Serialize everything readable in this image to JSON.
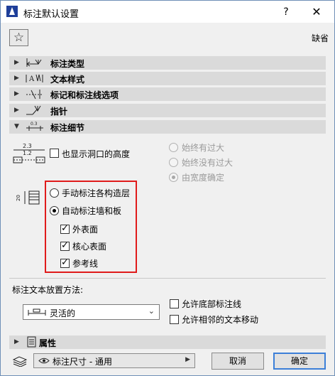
{
  "window": {
    "title": "标注默认设置",
    "help_label": "?",
    "close_label": "✕"
  },
  "toolbar": {
    "favorites_icon": "star-icon",
    "default_label": "缺省"
  },
  "sections": [
    {
      "label": "标注类型",
      "icon": "dimension-type-icon",
      "expanded": false
    },
    {
      "label": "文本样式",
      "icon": "text-style-icon",
      "expanded": false
    },
    {
      "label": "标记和标注线选项",
      "icon": "marker-options-icon",
      "expanded": false
    },
    {
      "label": "指针",
      "icon": "pointer-icon",
      "expanded": false
    },
    {
      "label": "标注细节",
      "icon": "dimension-detail-icon",
      "expanded": true
    }
  ],
  "details": {
    "icon_numbers": {
      "top": "2.3",
      "bottom": "1.2"
    },
    "show_opening_height": {
      "label": "也显示洞口的高度",
      "checked": false
    },
    "opening_options": [
      {
        "label": "始终有过大",
        "selected": false,
        "disabled": true
      },
      {
        "label": "始终没有过大",
        "selected": false,
        "disabled": true
      },
      {
        "label": "由宽度确定",
        "selected": true,
        "disabled": true
      }
    ],
    "wall_icon_number": "20",
    "wall_mode_options": [
      {
        "label": "手动标注各构造层",
        "selected": false
      },
      {
        "label": "自动标注墙和板",
        "selected": true
      }
    ],
    "auto_checks": [
      {
        "label": "外表面",
        "checked": true
      },
      {
        "label": "核心表面",
        "checked": true
      },
      {
        "label": "参考线",
        "checked": true
      }
    ]
  },
  "placement": {
    "heading": "标注文本放置方法:",
    "method_value": "灵活的",
    "allow_bottom": {
      "label": "允许底部标注线",
      "checked": false
    },
    "allow_adjacent": {
      "label": "允许相邻的文本移动",
      "checked": false
    }
  },
  "properties_section": {
    "label": "属性",
    "icon": "properties-icon",
    "expanded": false
  },
  "footer": {
    "layer_value": "标注尺寸 - 通用",
    "cancel_label": "取消",
    "ok_label": "确定"
  },
  "colors": {
    "highlight_box": "#e01b1b",
    "default_button_border": "#3c7fd8",
    "section_bg": "#dadada"
  }
}
